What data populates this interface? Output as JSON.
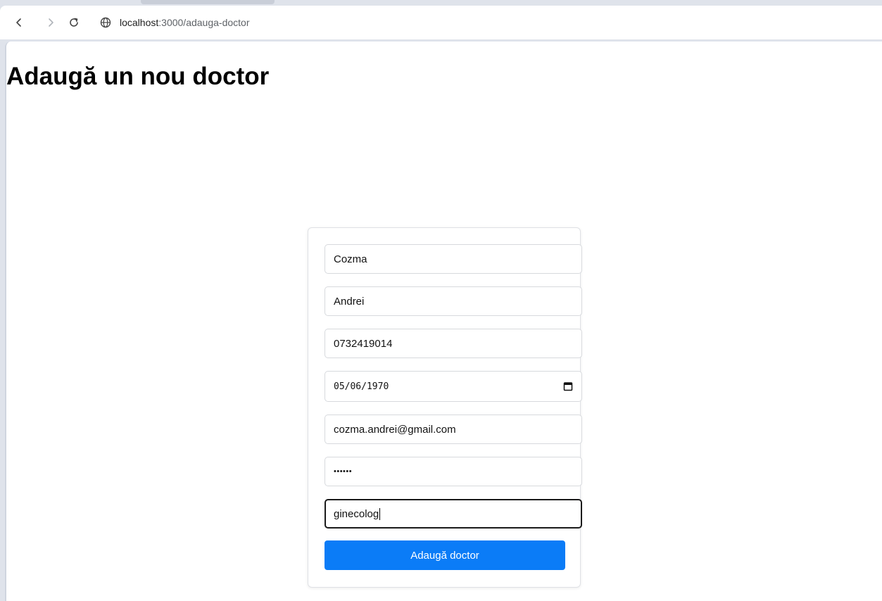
{
  "browser": {
    "url_host": "localhost",
    "url_path": ":3000/adauga-doctor"
  },
  "page": {
    "title": "Adaugă un nou doctor"
  },
  "form": {
    "last_name": "Cozma",
    "first_name": "Andrei",
    "phone": "0732419014",
    "birth_date": "05/06/1970",
    "email": "cozma.andrei@gmail.com",
    "password_masked": "••••••",
    "specialty": "ginecolog",
    "submit_label": "Adaugă doctor"
  },
  "colors": {
    "accent": "#0b7cf7"
  },
  "icons": {
    "back": "back-arrow-icon",
    "forward": "forward-arrow-icon",
    "reload": "reload-icon",
    "site_info": "globe-icon",
    "calendar": "calendar-icon"
  }
}
